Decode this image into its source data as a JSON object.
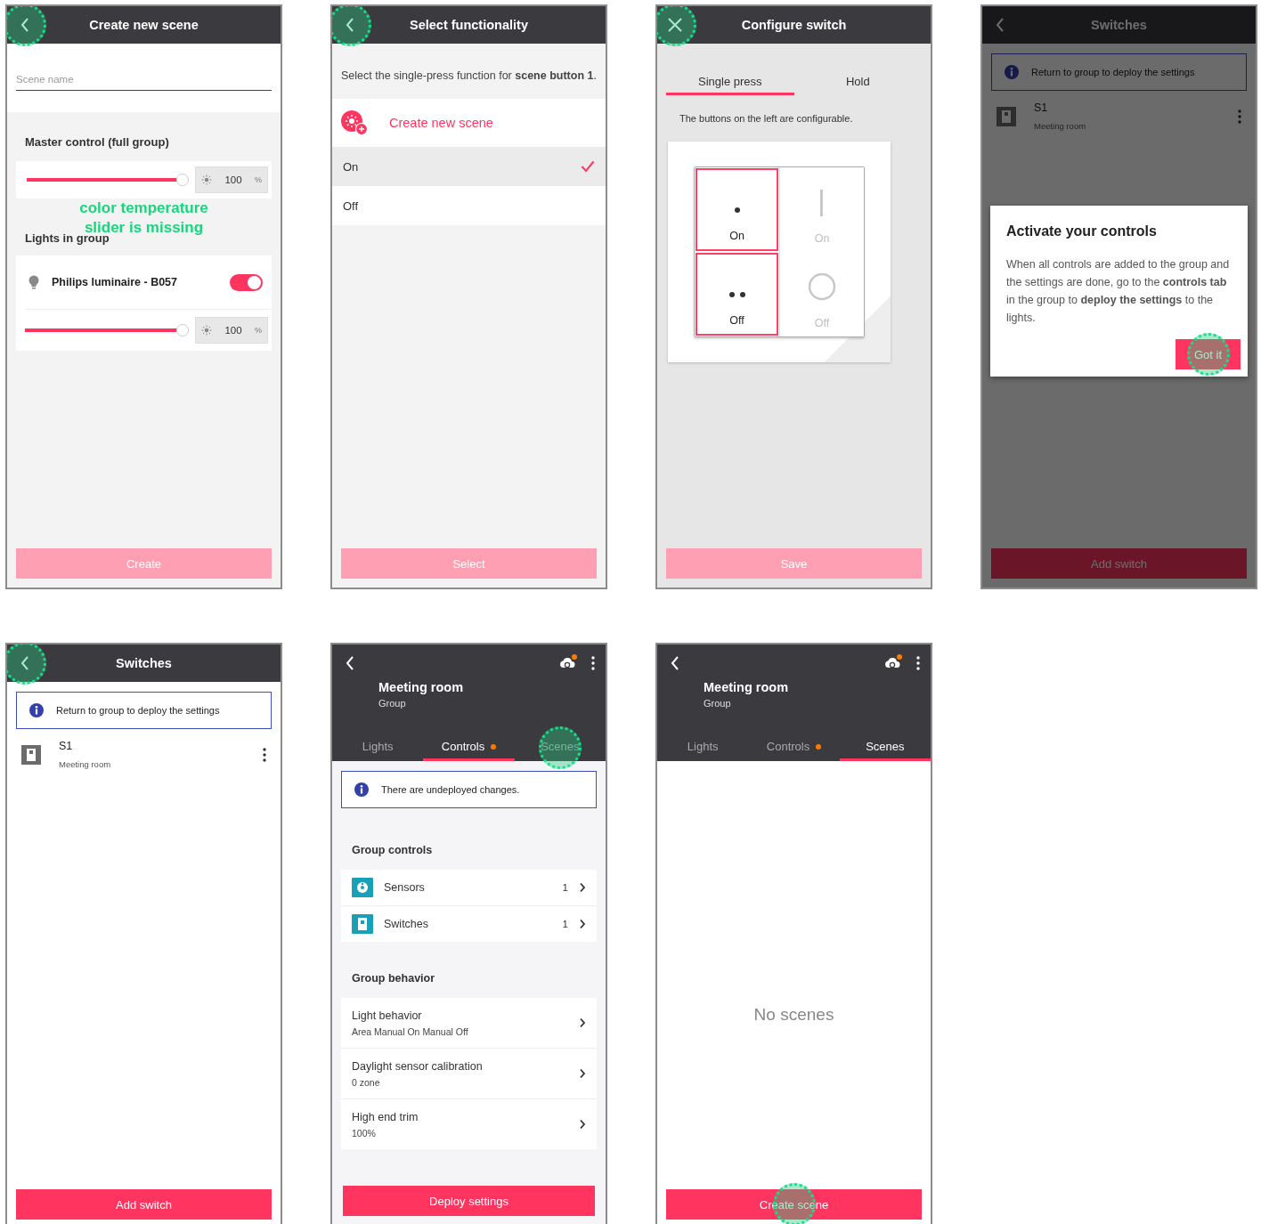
{
  "screens": [
    {
      "kind": "create_scene",
      "header": {
        "kind": "back",
        "title": "Create new scene",
        "tapped": true
      },
      "name_field": {
        "placeholder": "Scene name"
      },
      "master": {
        "heading": "Master control (full group)",
        "level": 0.98,
        "value": "100",
        "unit": "%"
      },
      "annotation": "color temperature slider is missing",
      "lights_heading": "Lights in group",
      "lights": [
        {
          "name": "Philips luminaire - B057",
          "on": true,
          "level": 0.98,
          "value": "100",
          "unit": "%"
        }
      ],
      "button": {
        "label": "Create",
        "disabled": true
      }
    },
    {
      "kind": "select_function",
      "header": {
        "kind": "back",
        "title": "Select functionality",
        "tapped": true
      },
      "instruction": "Select the single-press function for **scene button 1**.",
      "create_label": "Create new scene",
      "options": [
        {
          "label": "On",
          "selected": true
        },
        {
          "label": "Off",
          "selected": false
        }
      ],
      "button": {
        "label": "Select",
        "disabled": true
      }
    },
    {
      "kind": "configure_switch",
      "header": {
        "kind": "close",
        "title": "Configure switch",
        "tapped": true
      },
      "tabs": [
        {
          "label": "Single press",
          "selected": true
        },
        {
          "label": "Hold",
          "selected": false
        }
      ],
      "note": "The buttons on the left are configurable.",
      "keys": [
        {
          "kind": "dot",
          "label": "On",
          "configurable": true
        },
        {
          "kind": "bar",
          "label": "On",
          "configurable": false
        },
        {
          "kind": "two_dots",
          "label": "Off",
          "configurable": true
        },
        {
          "kind": "ring",
          "label": "Off",
          "configurable": false
        }
      ],
      "button": {
        "label": "Save",
        "disabled": true
      }
    },
    {
      "kind": "switches",
      "header": {
        "kind": "back",
        "title": "Switches"
      },
      "info": "Return to group to deploy the settings",
      "switches": [
        {
          "name": "S1",
          "room": "Meeting room"
        }
      ],
      "button": {
        "label": "Add switch",
        "disabled": false
      },
      "dialog": {
        "title": "Activate your controls",
        "body": "When all controls are added to the group and the settings are done, go to the **controls tab** in the group to **deploy the settings** to the lights.",
        "button": "Got it",
        "tapped": true
      }
    },
    {
      "kind": "switches",
      "header": {
        "kind": "back",
        "title": "Switches",
        "tapped": true
      },
      "info": "Return to group to deploy the settings",
      "switches": [
        {
          "name": "S1",
          "room": "Meeting room"
        }
      ],
      "button": {
        "label": "Add switch",
        "disabled": false
      }
    },
    {
      "kind": "group",
      "header": {
        "kind": "back",
        "title": "Meeting room",
        "subtitle": "Group",
        "cloud_badge": true
      },
      "tabs": [
        {
          "label": "Lights",
          "selected": false
        },
        {
          "label": "Controls",
          "selected": true,
          "badge": true
        },
        {
          "label": "Scenes",
          "selected": false,
          "tapped": true
        }
      ],
      "info": "There are undeployed changes.",
      "controls_heading": "Group controls",
      "controls": [
        {
          "kind": "sensor",
          "label": "Sensors",
          "count": "1"
        },
        {
          "kind": "switch",
          "label": "Switches",
          "count": "1"
        }
      ],
      "behavior_heading": "Group behavior",
      "behaviors": [
        {
          "label": "Light behavior",
          "value": "Area Manual On Manual Off"
        },
        {
          "label": "Daylight sensor calibration",
          "value": "0 zone"
        },
        {
          "label": "High end trim",
          "value": "100%"
        }
      ],
      "button": {
        "label": "Deploy settings",
        "disabled": false
      }
    },
    {
      "kind": "group",
      "header": {
        "kind": "back",
        "title": "Meeting room",
        "subtitle": "Group",
        "cloud_badge": true
      },
      "tabs": [
        {
          "label": "Lights",
          "selected": false
        },
        {
          "label": "Controls",
          "selected": false,
          "badge": true
        },
        {
          "label": "Scenes",
          "selected": true
        }
      ],
      "empty": "No scenes",
      "button": {
        "label": "Create scene",
        "disabled": false,
        "tapped": true
      }
    }
  ]
}
